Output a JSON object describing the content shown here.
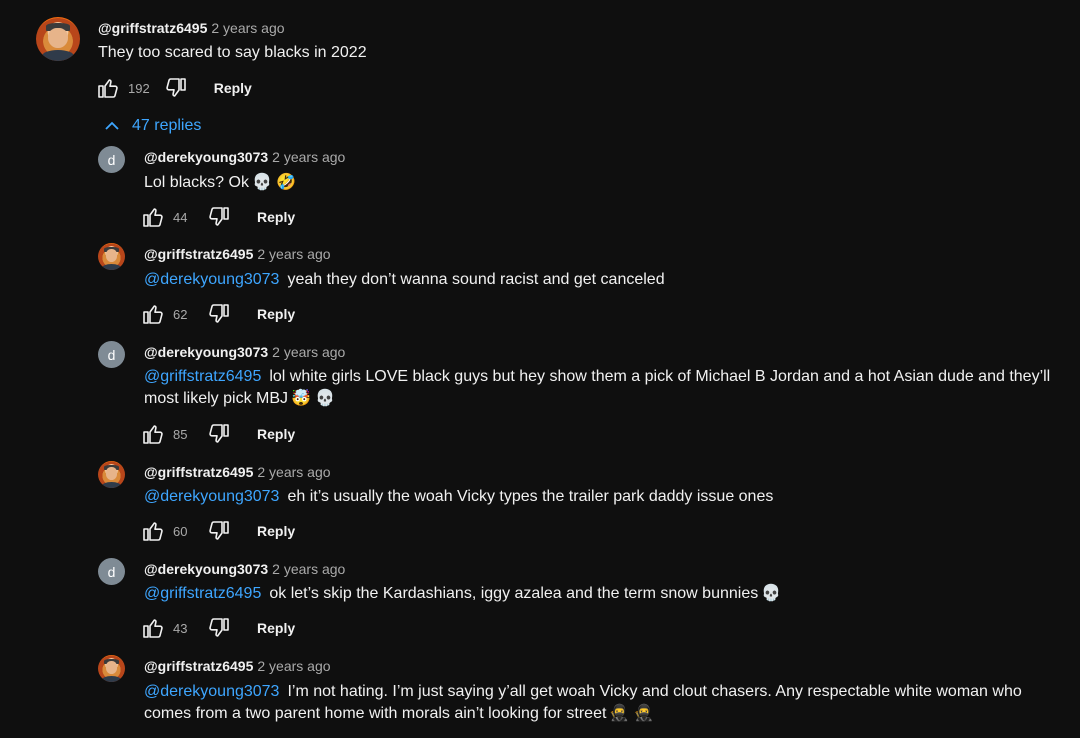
{
  "colors": {
    "background": "#0f0f0f",
    "text": "#f1f1f1",
    "secondary_text": "#aaaaaa",
    "link": "#3ea6ff",
    "letter_avatar": "#7f8b95"
  },
  "top_comment": {
    "author": "@griffstratz6495",
    "time": "2 years ago",
    "text": "They too scared to say blacks in 2022",
    "likes": "192",
    "reply_label": "Reply",
    "avatar": "profile-photo"
  },
  "replies_toggle": {
    "label": "47 replies",
    "icon": "chevron-up-icon"
  },
  "replies": [
    {
      "author": "@derekyoung3073",
      "time": "2 years ago",
      "avatar_letter": "d",
      "mention": "",
      "text": "Lol blacks? Ok",
      "emoji": "💀 🤣",
      "likes": "44",
      "reply_label": "Reply"
    },
    {
      "author": "@griffstratz6495",
      "time": "2 years ago",
      "avatar_letter": "",
      "mention": "@derekyoung3073",
      "text": "yeah they don’t wanna sound racist and get canceled",
      "emoji": "",
      "likes": "62",
      "reply_label": "Reply"
    },
    {
      "author": "@derekyoung3073",
      "time": "2 years ago",
      "avatar_letter": "d",
      "mention": "@griffstratz6495",
      "text": "lol white girls LOVE black guys but hey show them a pick of Michael B Jordan and a hot Asian dude and they’ll most likely pick MBJ",
      "emoji": "🤯 💀",
      "likes": "85",
      "reply_label": "Reply"
    },
    {
      "author": "@griffstratz6495",
      "time": "2 years ago",
      "avatar_letter": "",
      "mention": "@derekyoung3073",
      "text": "eh it’s usually the woah Vicky types the trailer park daddy issue ones",
      "emoji": "",
      "likes": "60",
      "reply_label": "Reply"
    },
    {
      "author": "@derekyoung3073",
      "time": "2 years ago",
      "avatar_letter": "d",
      "mention": "@griffstratz6495",
      "text": "ok let’s skip the Kardashians, iggy azalea and the term snow bunnies",
      "emoji": "💀",
      "likes": "43",
      "reply_label": "Reply"
    },
    {
      "author": "@griffstratz6495",
      "time": "2 years ago",
      "avatar_letter": "",
      "mention": "@derekyoung3073",
      "text": "I’m not hating. I’m just saying y’all get woah Vicky and clout chasers. Any respectable white woman who comes from a two parent home with morals ain’t looking for street",
      "emoji": "🥷 🥷",
      "likes": "",
      "reply_label": ""
    }
  ]
}
